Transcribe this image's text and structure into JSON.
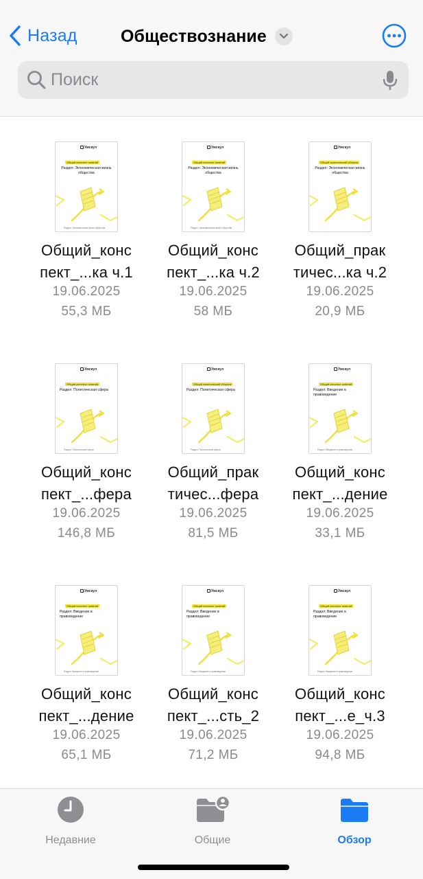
{
  "header": {
    "back_label": "Назад",
    "title": "Обществознание"
  },
  "search": {
    "placeholder": "Поиск"
  },
  "files": [
    {
      "name": "Общий_конс пект_...ка ч.1",
      "date": "19.06.2025",
      "size": "55,3 МБ",
      "thumb": {
        "brand": "Умскул",
        "tag": "Общий конспект занятий",
        "section": "Раздел: Экономическая жизнь общества",
        "footer": "Раздел: Экономическая жизнь общества"
      }
    },
    {
      "name": "Общий_конс пект_...ка ч.2",
      "date": "19.06.2025",
      "size": "58 МБ",
      "thumb": {
        "brand": "Умскул",
        "tag": "Общий конспект занятий",
        "section": "Раздел: Экономическая жизнь общества",
        "footer": "Раздел: Экономическая жизнь общества"
      }
    },
    {
      "name": "Общий_прак тичес...ка ч.2",
      "date": "19.06.2025",
      "size": "20,9 МБ",
      "thumb": {
        "brand": "Умскул",
        "tag": "Общий практический сборник",
        "section": "Раздел: Экономическая жизнь общества",
        "footer": ""
      }
    },
    {
      "name": "Общий_конс пект_...фера",
      "date": "19.06.2025",
      "size": "146,8 МБ",
      "thumb": {
        "brand": "Умскул",
        "tag": "Общий конспект занятий",
        "section": "Раздел: Политическая сфера",
        "footer": "Раздел: Политическая сфера"
      }
    },
    {
      "name": "Общий_прак тичес...фера",
      "date": "19.06.2025",
      "size": "81,5 МБ",
      "thumb": {
        "brand": "Умскул",
        "tag": "Общий практический сборник",
        "section": "Раздел: Политическая сфера",
        "footer": "Раздел: Политическая сфера"
      }
    },
    {
      "name": "Общий_конс пект_...дение",
      "date": "19.06.2025",
      "size": "33,1 МБ",
      "thumb": {
        "brand": "Умскул",
        "tag": "Общий конспект занятий",
        "section": "Раздел: Введение в правоведение",
        "footer": "Раздел: Введение в правоведение"
      }
    },
    {
      "name": "Общий_конс пект_...дение",
      "date": "19.06.2025",
      "size": "65,1 МБ",
      "thumb": {
        "brand": "Умскул",
        "tag": "Общий конспект занятий",
        "section": "Раздел: Введение в правоведение",
        "footer": "Раздел: Введение в правоведение"
      }
    },
    {
      "name": "Общий_конс пект_...сть_2",
      "date": "19.06.2025",
      "size": "71,2 МБ",
      "thumb": {
        "brand": "Умскул",
        "tag": "Общий конспект занятий",
        "section": "Раздел: Введение в правоведение",
        "footer": "Раздел: Введение в правоведение"
      }
    },
    {
      "name": "Общий_конс пект_...е_ч.3",
      "date": "19.06.2025",
      "size": "94,8 МБ",
      "thumb": {
        "brand": "Умскул",
        "tag": "Общий конспект занятий",
        "section": "Раздел: Введение в правоведение",
        "footer": "Раздел: Введение в правоведение"
      }
    }
  ],
  "tabs": [
    {
      "label": "Недавние",
      "icon": "clock-icon",
      "active": false
    },
    {
      "label": "Общие",
      "icon": "shared-folder-icon",
      "active": false
    },
    {
      "label": "Обзор",
      "icon": "folder-icon",
      "active": true
    }
  ],
  "colors": {
    "accent": "#1a7cf5",
    "thumb_highlight": "#f2e63c",
    "thumb_art": "#f4ec6a"
  }
}
